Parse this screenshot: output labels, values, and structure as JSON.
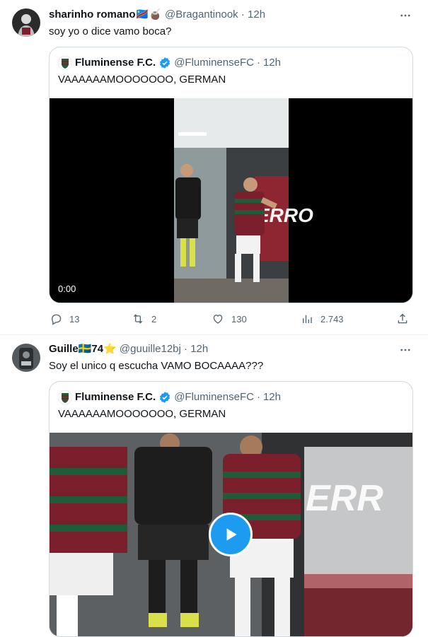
{
  "tweets": [
    {
      "display_name": "sharinho romano",
      "name_emojis": "🇨🇩🧉",
      "handle": "@Bragantinook",
      "separator": "·",
      "time": "12h",
      "text": "soy yo o dice vamo boca?",
      "quote": {
        "display_name": "Fluminense F.C.",
        "handle": "@FluminenseFC",
        "separator": "·",
        "time": "12h",
        "text": "VAAAAAAMOOOOOOO, GERMAN",
        "media_timecode": "0:00"
      },
      "stats": {
        "replies": "13",
        "retweets": "2",
        "likes": "130",
        "views": "2.743"
      }
    },
    {
      "display_name": "Guille",
      "name_emojis": "🇸🇪74⭐",
      "handle": "@guuille12bj",
      "separator": "·",
      "time": "12h",
      "text": "Soy el unico q escucha VAMO BOCAAAA???",
      "quote": {
        "display_name": "Fluminense F.C.",
        "handle": "@FluminenseFC",
        "separator": "·",
        "time": "12h",
        "text": "VAAAAAAMOOOOOOO, GERMAN"
      }
    }
  ],
  "icons": {
    "more": "more-dots-icon",
    "reply": "reply-icon",
    "retweet": "retweet-icon",
    "like": "heart-icon",
    "views": "views-icon",
    "share": "share-icon",
    "verified": "verified-badge-icon",
    "play": "play-icon"
  },
  "colors": {
    "verified": "#1d9bf0",
    "muted": "#536471",
    "border": "#cfd9de",
    "play": "#1d9bf0",
    "fluminense_maroon": "#7a1f2b",
    "fluminense_green": "#1f5c3a"
  }
}
